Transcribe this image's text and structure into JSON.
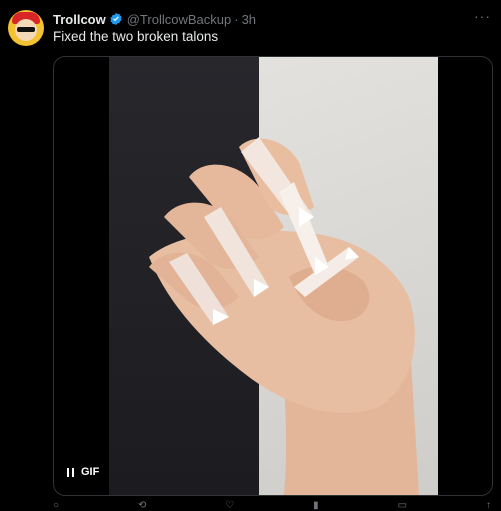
{
  "tweet": {
    "display_name": "Trollcow",
    "handle": "@TrollcowBackup",
    "separator": "·",
    "time": "3h",
    "text": "Fixed the two broken talons",
    "more_label": "···"
  },
  "media": {
    "badge_label": "GIF",
    "type": "gif"
  },
  "colors": {
    "verified": "#1d9bf0",
    "secondary_text": "#71767b",
    "primary_text": "#e7e9ea"
  },
  "actions": [
    "reply-icon",
    "repost-icon",
    "like-icon",
    "views-icon",
    "bookmark-icon",
    "share-icon"
  ]
}
